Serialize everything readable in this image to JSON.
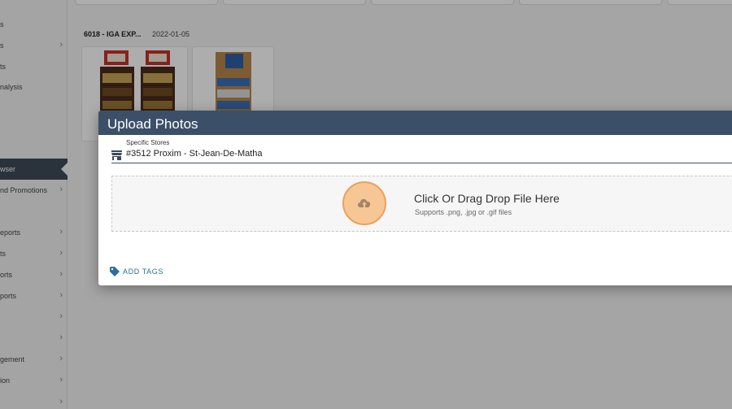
{
  "sidebar": {
    "items": [
      {
        "label": "s",
        "chevron": false
      },
      {
        "label": "s",
        "chevron": true
      },
      {
        "label": "ts",
        "chevron": false
      },
      {
        "label": "nalysis",
        "chevron": false
      },
      {
        "label": "wser",
        "chevron": false,
        "active": true
      },
      {
        "label": "nd Promotions",
        "chevron": true
      },
      {
        "label": "eports",
        "chevron": true
      },
      {
        "label": "ts",
        "chevron": true
      },
      {
        "label": "orts",
        "chevron": true
      },
      {
        "label": "ports",
        "chevron": true
      },
      {
        "label": "",
        "chevron": true
      },
      {
        "label": "",
        "chevron": true
      },
      {
        "label": "gement",
        "chevron": true
      },
      {
        "label": "ion",
        "chevron": true
      },
      {
        "label": "",
        "chevron": true
      }
    ],
    "chevron_glyph": "›"
  },
  "gallery": {
    "title": "6018 - IGA EXP...",
    "date": "2022-01-05"
  },
  "modal": {
    "title": "Upload Photos",
    "field_label": "Specific Stores",
    "field_value": "#3512 Proxim - St-Jean-De-Matha",
    "dropzone_title": "Click Or Drag Drop File Here",
    "dropzone_subtitle": "Supports .png, .jpg or .gif files",
    "add_tags_label": "ADD TAGS",
    "icons": {
      "store": "store-icon",
      "upload": "cloud-upload-icon",
      "tag": "tag-icon"
    }
  },
  "colors": {
    "header_bg": "#3b5068",
    "upload_circle": "#f7c695",
    "upload_ring": "#eea05a",
    "link_blue": "#2c6f9e",
    "sidebar_active": "#3f4a57"
  }
}
